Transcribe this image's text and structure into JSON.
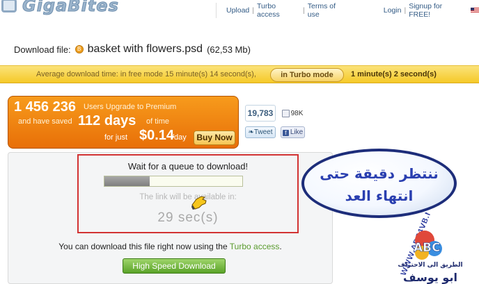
{
  "header": {
    "logo_text": "GigaBites",
    "nav": {
      "upload": "Upload",
      "turbo": "Turbo access",
      "terms": "Terms of use",
      "login": "Login",
      "signup": "Signup for FREE!"
    }
  },
  "download": {
    "label": "Download file:",
    "file_name": "basket with flowers.psd",
    "file_size": "(62,53 Mb)"
  },
  "timebar": {
    "free_mode": "Average download time: in free mode 15 minute(s) 14 second(s),",
    "turbo_button": "in Turbo mode",
    "turbo_time": "1 minute(s) 2 second(s)"
  },
  "premium": {
    "users_count": "1 456 236",
    "users_text": "Users Upgrade to Premium",
    "saved_text": "and have saved",
    "days": "112 days",
    "of_time": "of time",
    "for_just": "for just",
    "price": "$0.14",
    "per_day": "/day",
    "buy_button": "Buy Now"
  },
  "social": {
    "tweet_count": "19,783",
    "like_count": "98K",
    "tweet_button": "Tweet",
    "like_button": "Like"
  },
  "queue": {
    "wait_text": "Wait for a queue to download!",
    "progress": 0.33,
    "link_text": "The link will be available in:",
    "countdown": "29 sec(s)"
  },
  "turbo_access": {
    "prefix": "You can download this file right now using the",
    "link": "Turbo access",
    "suffix": ".",
    "button": "High Speed Download"
  },
  "annotation": {
    "line1": "ننتظر دقيقة حتى",
    "line2": "انتهاء العد"
  },
  "colors": {
    "timebar": "#f5c928",
    "premium": "#e86f08",
    "annotation_border": "#1d2d7a",
    "annotation_text": "#2a3fb0",
    "red_frame": "#d23333",
    "hs_button": "#5aa328"
  },
  "watermark": {
    "site": "WWW.ABC4VB.NET",
    "letters": "ABC",
    "tagline": "الطريق الى الاحتراف",
    "author": "ابو يوسف"
  }
}
